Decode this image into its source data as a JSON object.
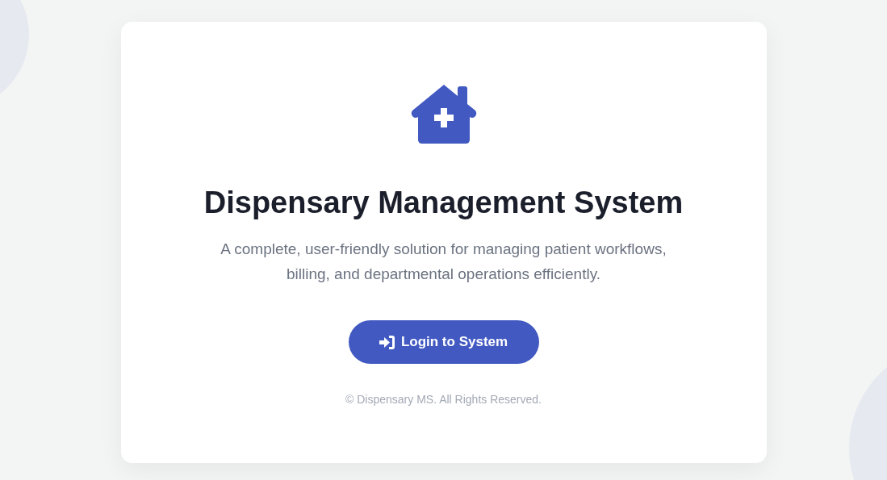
{
  "title": "Dispensary Management System",
  "subtitle": "A complete, user-friendly solution for managing patient workflows, billing, and departmental operations efficiently.",
  "login_button": {
    "label": "Login to System"
  },
  "footer": "© Dispensary MS. All Rights Reserved."
}
